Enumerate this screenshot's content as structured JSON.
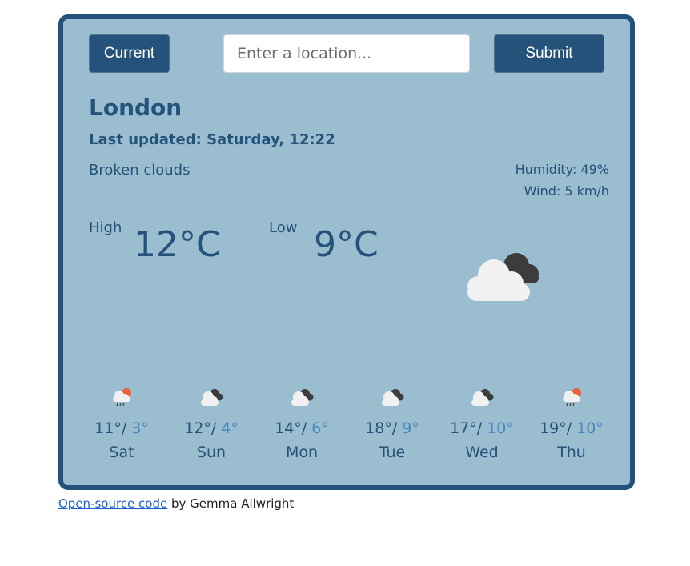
{
  "header": {
    "current_label": "Current",
    "search_placeholder": "Enter a location...",
    "submit_label": "Submit"
  },
  "weather": {
    "city": "London",
    "last_updated": "Last updated: Saturday, 12:22",
    "description": "Broken clouds",
    "humidity": "Humidity: 49%",
    "wind": "Wind: 5 km/h",
    "high_label": "High",
    "high_temp": "12°C",
    "low_label": "Low",
    "low_temp": "9°C",
    "icon": "broken-clouds-icon"
  },
  "forecast": [
    {
      "high": "11°/",
      "low": "3°",
      "day": "Sat",
      "icon": "rain-sun-icon"
    },
    {
      "high": "12°/",
      "low": "4°",
      "day": "Sun",
      "icon": "broken-clouds-icon"
    },
    {
      "high": "14°/",
      "low": "6°",
      "day": "Mon",
      "icon": "broken-clouds-icon"
    },
    {
      "high": "18°/",
      "low": "9°",
      "day": "Tue",
      "icon": "broken-clouds-icon"
    },
    {
      "high": "17°/",
      "low": "10°",
      "day": "Wed",
      "icon": "broken-clouds-icon"
    },
    {
      "high": "19°/",
      "low": "10°",
      "day": "Thu",
      "icon": "rain-sun-icon"
    }
  ],
  "footer": {
    "link_text": "Open-source code",
    "by_text": " by Gemma Allwright"
  },
  "colors": {
    "card_bg": "#9bbdd0",
    "accent": "#24527a",
    "low_temp": "#4a87c0"
  }
}
